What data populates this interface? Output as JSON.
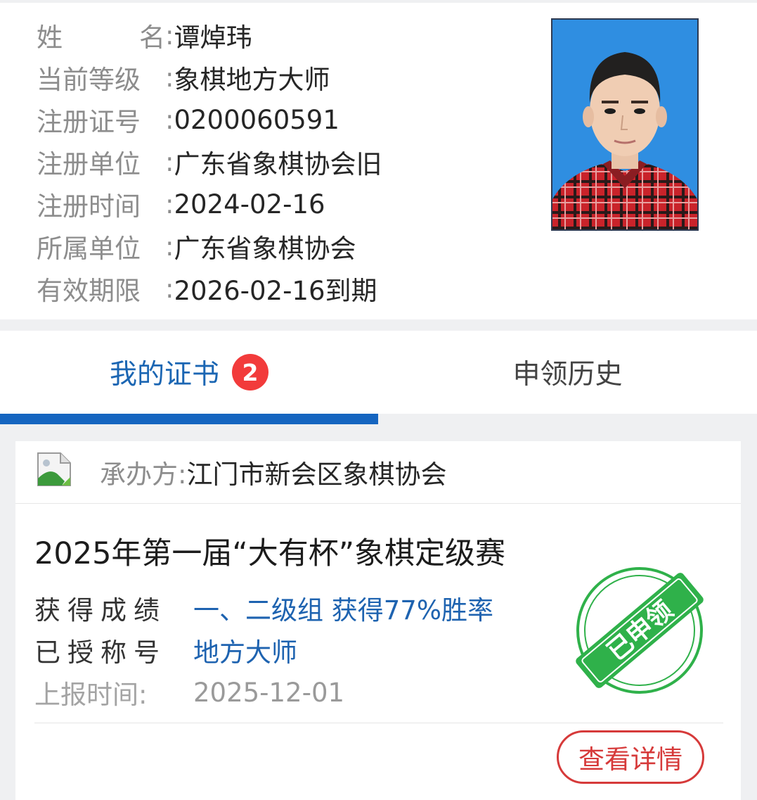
{
  "profile": {
    "rows": [
      {
        "label": [
          "姓",
          "名"
        ],
        "value": "谭焯玮"
      },
      {
        "label": [
          "当前等级"
        ],
        "value": "象棋地方大师"
      },
      {
        "label": [
          "注册证号"
        ],
        "value": "0200060591"
      },
      {
        "label": [
          "注册单位"
        ],
        "value": "广东省象棋协会旧"
      },
      {
        "label": [
          "注册时间"
        ],
        "value": "2024-02-16"
      },
      {
        "label": [
          "所属单位"
        ],
        "value": "广东省象棋协会"
      },
      {
        "label": [
          "有效期限"
        ],
        "value": "2026-02-16到期"
      }
    ],
    "colon": ":"
  },
  "tabs": {
    "my_certificates": "我的证书",
    "badge_count": "2",
    "history": "申领历史"
  },
  "card": {
    "organizer_label": "承办方:",
    "organizer_name": "江门市新会区象棋协会",
    "event_title": "2025年第一届“大有杯”象棋定级赛",
    "result_label": "获得成绩",
    "result_value": "一、二级组 获得77%胜率",
    "title_label": "已授称号",
    "title_value": "地方大师",
    "report_label": "上报时间:",
    "report_value": "2025-12-01",
    "stamp_text": "已申领",
    "details_button": "查看详情"
  },
  "colors": {
    "accent": "#1565c0",
    "badge": "#f23b3b",
    "stamp": "#2fb14a",
    "details_button": "#d63a3a"
  },
  "icons": {
    "organizer_logo": "broken-image-icon"
  }
}
